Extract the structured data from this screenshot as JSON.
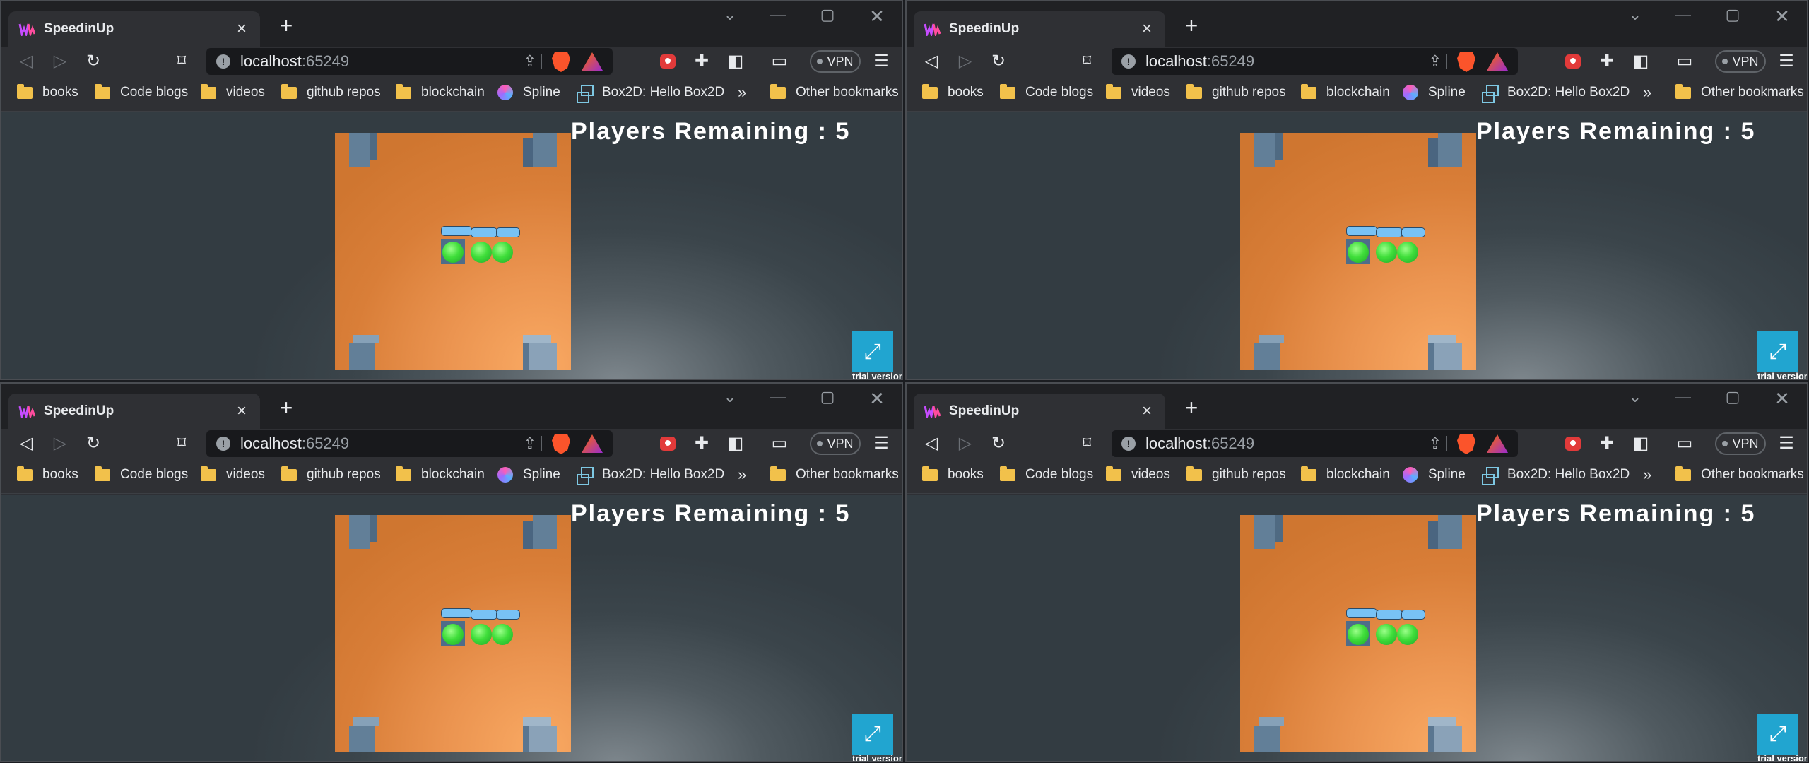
{
  "windows": [
    {
      "tab_title": "SpeedinUp",
      "url_host": "localhost",
      "url_port": ":65249",
      "vpn_label": "VPN",
      "bookmarks": [
        "books",
        "Code blogs",
        "videos",
        "github repos",
        "blockchain",
        "Spline",
        "Box2D: Hello Box2D"
      ],
      "other_bookmarks": "Other bookmarks",
      "game": {
        "players_remaining": "Players Remaining : 5",
        "trial_label": "trial version"
      }
    },
    {
      "tab_title": "SpeedinUp",
      "url_host": "localhost",
      "url_port": ":65249",
      "vpn_label": "VPN",
      "bookmarks": [
        "books",
        "Code blogs",
        "videos",
        "github repos",
        "blockchain",
        "Spline",
        "Box2D: Hello Box2D"
      ],
      "other_bookmarks": "Other bookmarks",
      "game": {
        "players_remaining": "Players Remaining : 5",
        "trial_label": "trial version"
      }
    },
    {
      "tab_title": "SpeedinUp",
      "url_host": "localhost",
      "url_port": ":65249",
      "vpn_label": "VPN",
      "bookmarks": [
        "books",
        "Code blogs",
        "videos",
        "github repos",
        "blockchain",
        "Spline",
        "Box2D: Hello Box2D"
      ],
      "other_bookmarks": "Other bookmarks",
      "game": {
        "players_remaining": "Players Remaining : 5",
        "trial_label": "trial version"
      }
    },
    {
      "tab_title": "SpeedinUp",
      "url_host": "localhost",
      "url_port": ":65249",
      "vpn_label": "VPN",
      "bookmarks": [
        "books",
        "Code blogs",
        "videos",
        "github repos",
        "blockchain",
        "Spline",
        "Box2D: Hello Box2D"
      ],
      "other_bookmarks": "Other bookmarks",
      "game": {
        "players_remaining": "Players Remaining : 5",
        "trial_label": "trial version"
      }
    }
  ],
  "colors": {
    "arena": "#e08a42",
    "pillar": "#627f98",
    "ball": "#3fde3a",
    "name_tag": "#78c2f5",
    "fullscreen_button": "#21a5d0",
    "bookmark_folder": "#f2c14b"
  },
  "icons": {
    "favicon": "speedinup-logo-icon",
    "back": "back-arrow-icon",
    "forward": "forward-arrow-icon",
    "reload": "reload-icon",
    "bookmark": "bookmark-icon",
    "site_info": "info-icon",
    "share": "share-icon",
    "brave_shields": "brave-lion-icon",
    "brave_rewards": "brave-rewards-icon",
    "record": "record-extension-icon",
    "extensions": "puzzle-icon",
    "sidebar": "sidebar-icon",
    "wallet": "wallet-icon",
    "menu": "hamburger-menu-icon",
    "fullscreen": "expand-icon"
  }
}
